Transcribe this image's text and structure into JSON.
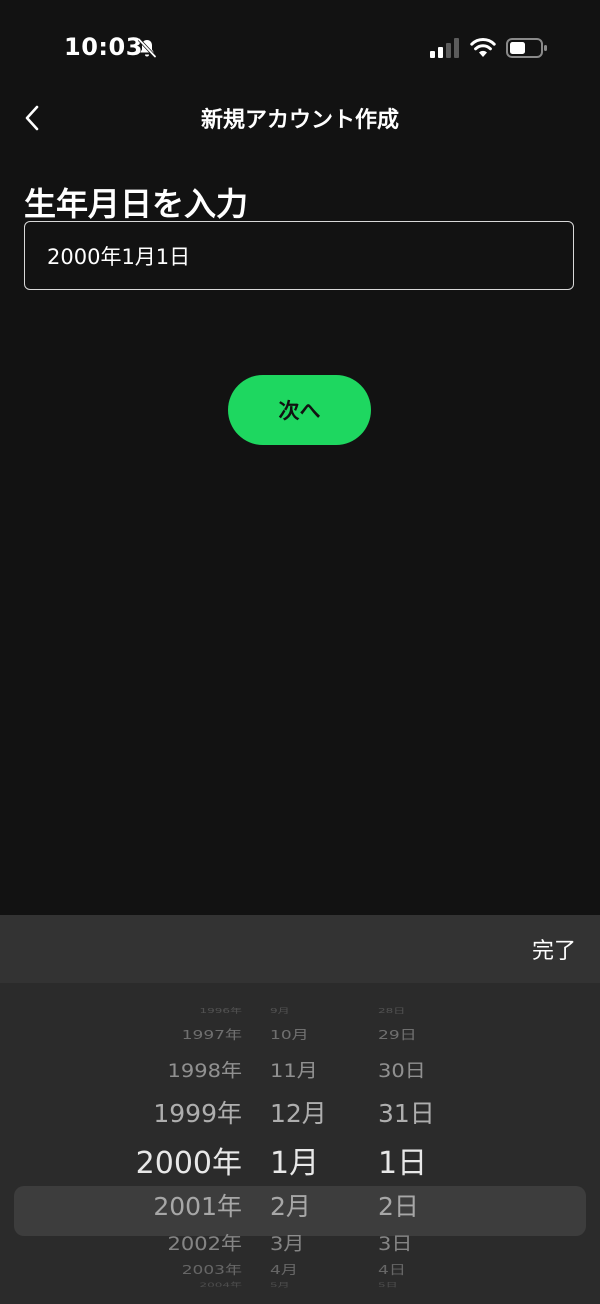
{
  "status_bar": {
    "time": "10:03",
    "icons": [
      "bell-slash-icon",
      "signal-icon",
      "wifi-icon",
      "battery-icon"
    ]
  },
  "nav": {
    "title": "新規アカウント作成",
    "back_icon": "chevron-left-icon"
  },
  "form": {
    "heading": "生年月日を入力",
    "date_value": "2000年1月1日"
  },
  "next_button": {
    "label": "次へ",
    "color": "#1ed760"
  },
  "picker": {
    "done_label": "完了",
    "years": [
      "1996年",
      "1997年",
      "1998年",
      "1999年",
      "2000年",
      "2001年",
      "2002年",
      "2003年",
      "2004年"
    ],
    "months": [
      "9月",
      "10月",
      "11月",
      "12月",
      "1月",
      "2月",
      "3月",
      "4月",
      "5月"
    ],
    "days": [
      "28日",
      "29日",
      "30日",
      "31日",
      "1日",
      "2日",
      "3日",
      "4日",
      "5日"
    ],
    "selected": {
      "year": "2000年",
      "month": "1月",
      "day": "1日"
    }
  }
}
